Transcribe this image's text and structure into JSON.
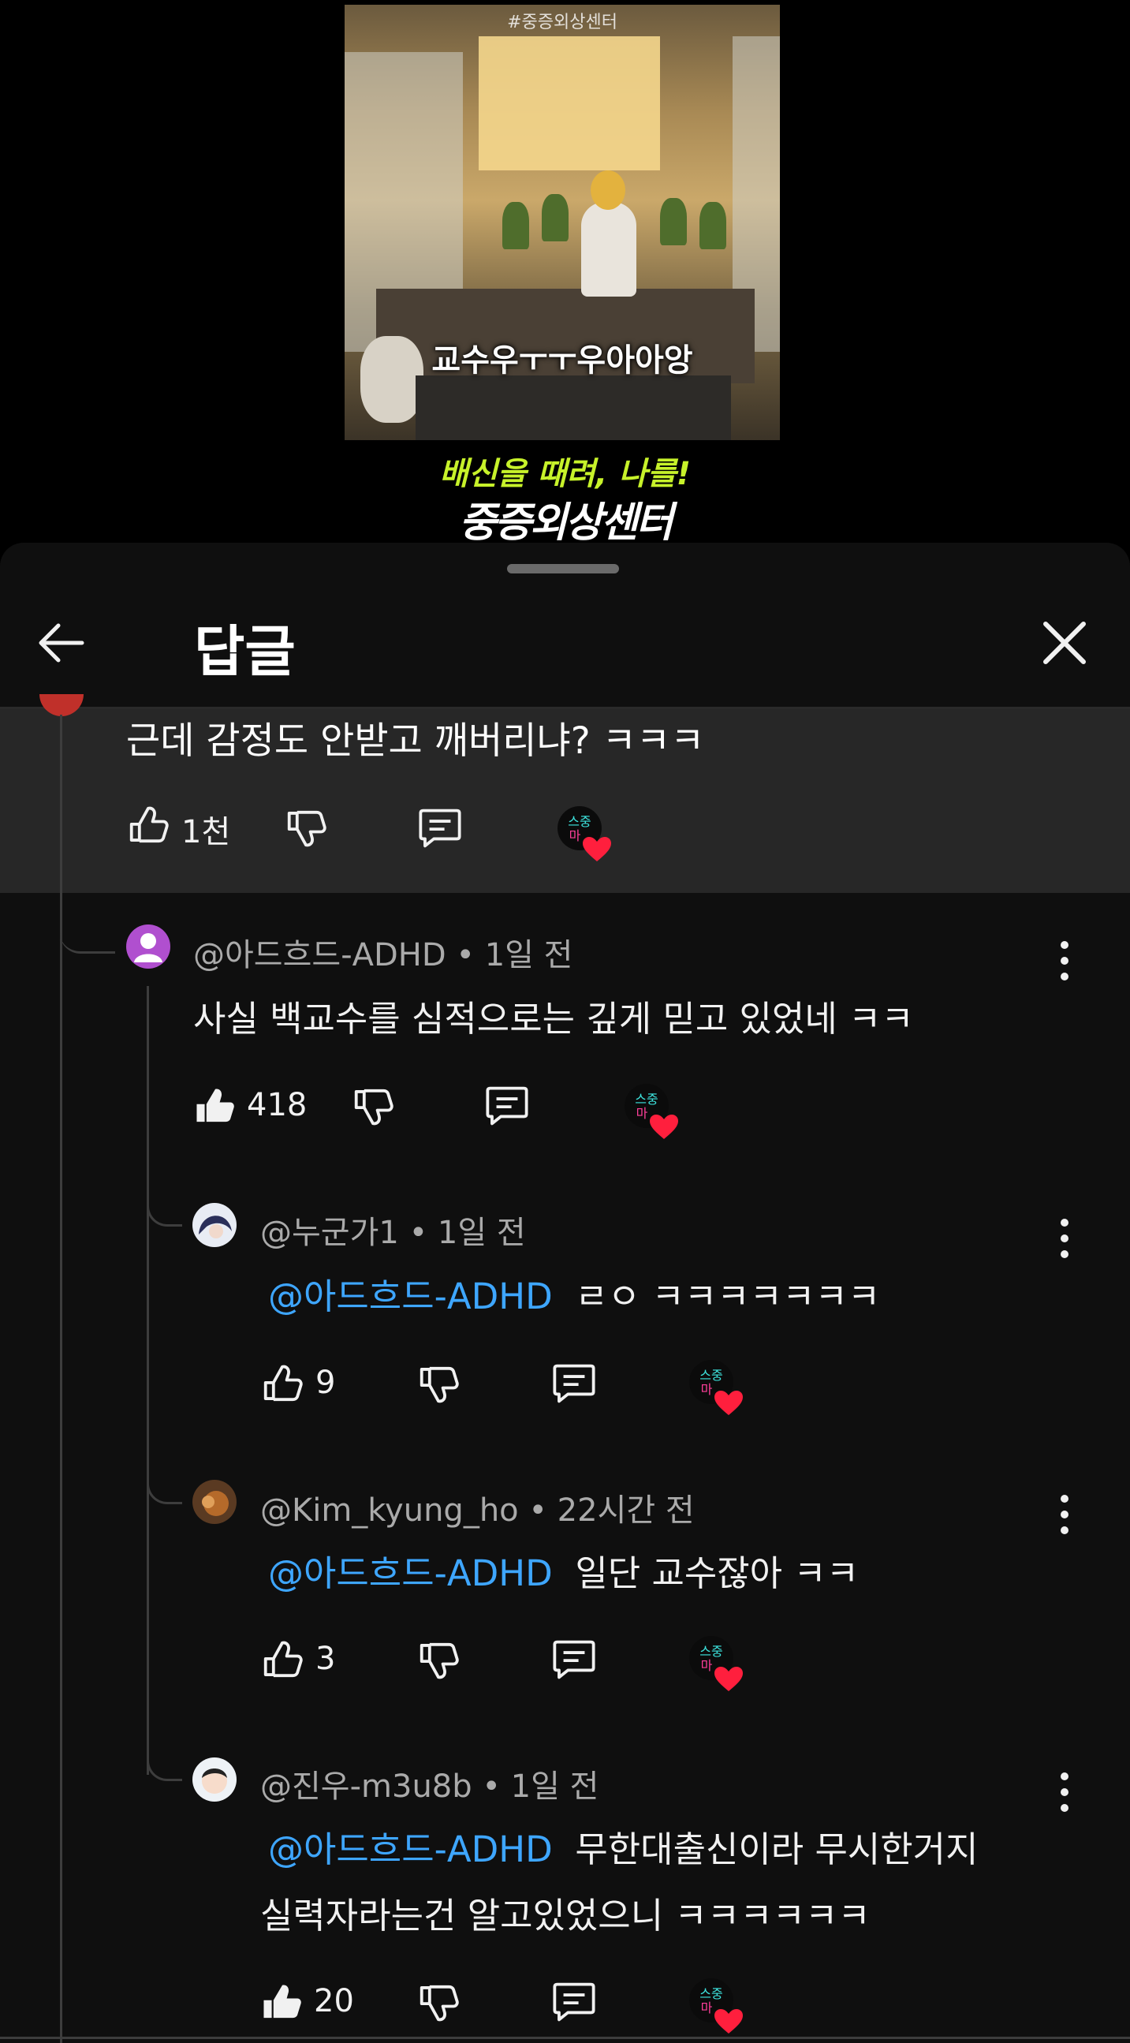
{
  "video": {
    "thumbnail_tag": "#중증외상센터",
    "subtitle": "교수우ㅜㅜ우아아앙",
    "promo_line1": "배신을 때려, 나를!",
    "promo_line2": "중증외상센터"
  },
  "sheet": {
    "title": "답글"
  },
  "parent_comment": {
    "text": "근데 감정도 안받고 깨버리냐? ㅋㅋㅋ",
    "likes": "1천",
    "creator_badge": "스중마"
  },
  "replies": [
    {
      "author": "@아드흐드-ADHD",
      "time": "1일 전",
      "mention": "",
      "line1": "사실 백교수를 심적으로는 깊게 믿고 있었네 ㅋㅋ",
      "line2": "",
      "likes": "418",
      "liked": true
    },
    {
      "author": "@누군가1",
      "time": "1일 전",
      "mention": "@아드흐드-ADHD",
      "line1": "ㄹㅇ ㅋㅋㅋㅋㅋㅋㅋ",
      "line2": "",
      "likes": "9",
      "liked": false
    },
    {
      "author": "@Kim_kyung_ho",
      "time": "22시간 전",
      "mention": "@아드흐드-ADHD",
      "line1": "일단 교수잖아 ㅋㅋ",
      "line2": "",
      "likes": "3",
      "liked": false
    },
    {
      "author": "@진우-m3u8b",
      "time": "1일 전",
      "mention": "@아드흐드-ADHD",
      "line1": "무한대출신이라 무시한거지",
      "line2": "실력자라는건 알고있었으니 ㅋㅋㅋㅋㅋㅋ",
      "likes": "20",
      "liked": true
    }
  ],
  "icons": {
    "back": "arrow-left-icon",
    "close": "close-icon",
    "like": "thumbs-up-icon",
    "dislike": "thumbs-down-icon",
    "reply": "reply-icon",
    "more": "kebab-icon",
    "heart": "creator-heart-icon"
  },
  "colors": {
    "mention": "#3ea6ff",
    "heart": "#ff1f3d",
    "sheet_bg": "#0f0f0f",
    "parent_bg": "#272727"
  }
}
